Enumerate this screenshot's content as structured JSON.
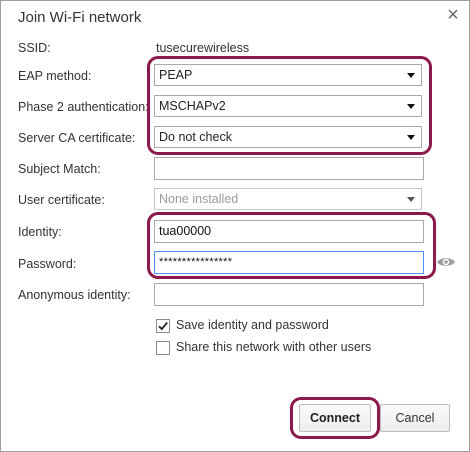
{
  "dialog": {
    "title": "Join Wi-Fi network",
    "close_label": "×"
  },
  "form": {
    "ssid_label": "SSID:",
    "ssid_value": "tusecurewireless",
    "eap_label": "EAP method:",
    "eap_value": "PEAP",
    "phase2_label": "Phase 2 authentication:",
    "phase2_value": "MSCHAPv2",
    "server_ca_label": "Server CA certificate:",
    "server_ca_value": "Do not check",
    "subject_match_label": "Subject Match:",
    "subject_match_value": "",
    "user_cert_label": "User certificate:",
    "user_cert_value": "None installed",
    "identity_label": "Identity:",
    "identity_value": "tua00000",
    "password_label": "Password:",
    "password_value": "****************",
    "anon_identity_label": "Anonymous identity:",
    "anon_identity_value": ""
  },
  "options": {
    "save_identity_label": "Save identity and password",
    "save_identity_checked": true,
    "share_network_label": "Share this network with other users",
    "share_network_checked": false
  },
  "buttons": {
    "connect_label": "Connect",
    "cancel_label": "Cancel"
  },
  "colors": {
    "highlight": "#8b1a4a",
    "focus": "#4d90fe"
  },
  "icons": {
    "password_toggle": "eye-icon",
    "checkmark": "checkmark-icon"
  }
}
